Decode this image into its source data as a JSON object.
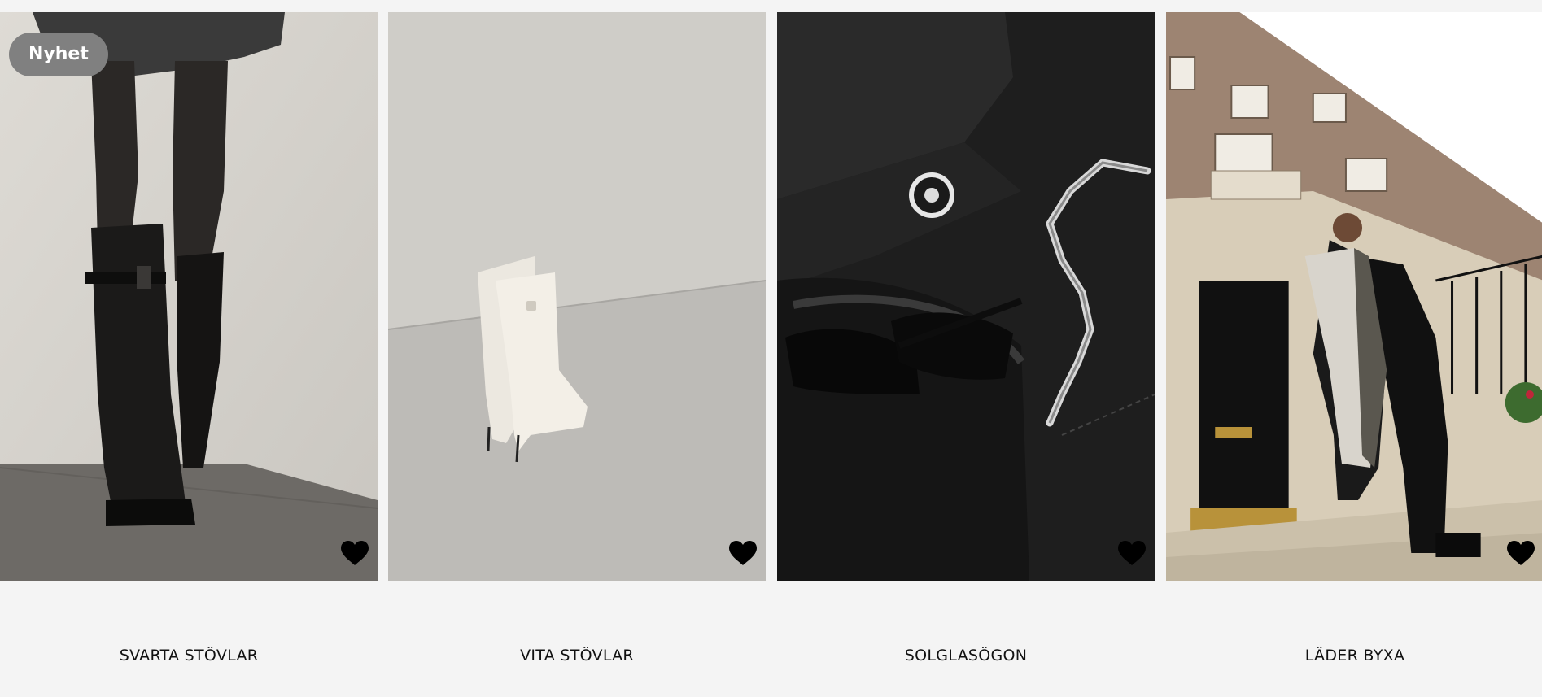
{
  "products": [
    {
      "title": "SVARTA STÖVLAR",
      "badge": "Nyhet",
      "image": "black-knee-boots-photo",
      "favorite_icon": "heart-icon"
    },
    {
      "title": "VITA STÖVLAR",
      "image": "white-boots-photo",
      "favorite_icon": "heart-icon"
    },
    {
      "title": "SOLGLASÖGON",
      "image": "sunglasses-and-bag-photo",
      "favorite_icon": "heart-icon"
    },
    {
      "title": "LÄDER BYXA",
      "image": "leather-pants-street-photo",
      "favorite_icon": "heart-icon"
    }
  ],
  "colors": {
    "page_background": "#f4f4f4",
    "badge_background": "#808080",
    "badge_text": "#ffffff",
    "title_text": "#111111",
    "heart": "#000000"
  }
}
